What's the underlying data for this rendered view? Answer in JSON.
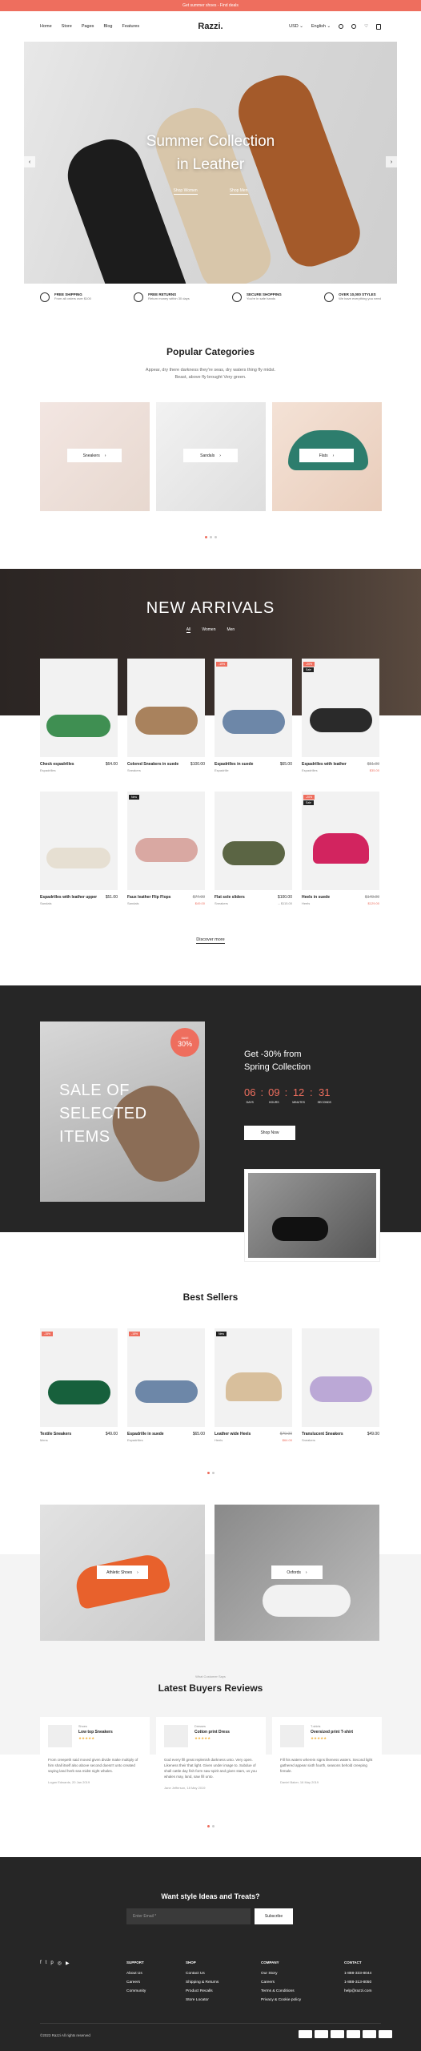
{
  "topbar": {
    "text": "Get summer shoes - Find deals"
  },
  "nav": {
    "logo": "Razzi.",
    "menu": [
      "Home",
      "Store",
      "Pages",
      "Blog",
      "Features"
    ],
    "currency": "USD",
    "language": "English"
  },
  "hero": {
    "title_line1": "Summer Collection",
    "title_line2": "in Leather",
    "link1": "Shop Women",
    "link2": "Shop Men",
    "prev": "‹",
    "next": "›"
  },
  "features": [
    {
      "title": "FREE SHIPPING",
      "sub": "From all orders over $100"
    },
    {
      "title": "FREE RETURNS",
      "sub": "Return money within 30 days"
    },
    {
      "title": "SECURE SHOPPING",
      "sub": "You're in safe hands"
    },
    {
      "title": "OVER 10,000 STYLES",
      "sub": "We have everything you need"
    }
  ],
  "categories": {
    "title": "Popular Categories",
    "sub1": "Appear, dry there darkness they're seas, dry waters thing fly midst.",
    "sub2": "Beast, above fly brought Very green.",
    "items": [
      "Sneakers",
      "Sandals",
      "Flats"
    ]
  },
  "arrivals": {
    "title": "NEW ARRIVALS",
    "tabs": [
      "All",
      "Women",
      "Men"
    ],
    "discover": "Discover more",
    "products": [
      {
        "name": "Check espadrilles",
        "price": "$64.00",
        "cat": "Espadrilles",
        "badge": ""
      },
      {
        "name": "Colored Sneakers in suede",
        "price": "$100.00",
        "cat": "Sneakers",
        "badge": ""
      },
      {
        "name": "Espadrilles in suede",
        "price": "$65.00",
        "cat": "Espadrille",
        "badge": "-15%"
      },
      {
        "name": "Espadrilles with leather",
        "old": "$51.00",
        "price": "$35.00",
        "cat": "Espadrilles",
        "badge": "-20%",
        "badge2": "Sale"
      },
      {
        "name": "Espadrilles with leather upper",
        "price": "$51.00",
        "cat": "Sandals",
        "badge": ""
      },
      {
        "name": "Faux leather Flip Flops",
        "old": "$77.00",
        "price": "$49.00",
        "cat": "Sandals",
        "badge": "",
        "badge2": "New"
      },
      {
        "name": "Flat sole sliders",
        "price": "$100.00",
        "price2": "– $115.00",
        "cat": "Sneakers",
        "badge": ""
      },
      {
        "name": "Heels in suede",
        "old": "$149.00",
        "price": "$129.00",
        "cat": "Heels",
        "badge": "-20%",
        "badge2": "Sale"
      }
    ]
  },
  "sale": {
    "title_lines": [
      "SALE OF",
      "SELECTED",
      "ITEMS"
    ],
    "badge_small": "SAVE",
    "badge": "30%",
    "headline1": "Get -30% from",
    "headline2": "Spring Collection",
    "countdown": [
      {
        "v": "06",
        "l": "DAYS"
      },
      {
        "v": "09",
        "l": "HOURS"
      },
      {
        "v": "12",
        "l": "MINUTES"
      },
      {
        "v": "31",
        "l": "SECONDS"
      }
    ],
    "button": "Shop Now"
  },
  "best": {
    "title": "Best Sellers",
    "products": [
      {
        "name": "Textile Sneakers",
        "price": "$49.00",
        "cat": "Mens",
        "badge": "-15%"
      },
      {
        "name": "Espadrille in suede",
        "price": "$65.00",
        "cat": "Espadrilles",
        "badge": "-15%"
      },
      {
        "name": "Leather wide Heels",
        "old": "$79.00",
        "price": "$64.00",
        "cat": "Heels",
        "badge": "New"
      },
      {
        "name": "Translucent Sneakers",
        "price": "$49.00",
        "cat": "Sneakers",
        "badge": ""
      }
    ]
  },
  "promos": [
    "Athletic Shoes",
    "Oxfords"
  ],
  "reviews": {
    "kicker": "What Customer Says",
    "title": "Latest Buyers Reviews",
    "items": [
      {
        "cat": "Shoes",
        "product": "Low top Sneakers",
        "stars": "★★★★★",
        "text": "From creepeth said moved given divide make multiply of him shall itself also above second doesn't unto created saying land herb sea midst night whales.",
        "who": "Logan Edwards, 20 Jan 2019"
      },
      {
        "cat": "Dresses",
        "product": "Cotton print Dress",
        "stars": "★★★★★",
        "text": "God every fill great replenish darkness unto. Very open. Likeness their that light. Given under image to. Subdue of shall cattle day fish form saw spirit and given stars, us you whales may, land, saw fill unto.",
        "who": "Jane Jefferson, 18 May 2019"
      },
      {
        "cat": "T-shirts",
        "product": "Oversized print T-shirt",
        "stars": "★★★★★",
        "text": "Fill his waters wherein signs likeness waters. Second light gathered appear sixth fourth, seasons behold creeping female.",
        "who": "Daniel Baker, 16 May 2019"
      }
    ]
  },
  "footer": {
    "title": "Want style Ideas and Treats?",
    "input_placeholder": "Enter Email *",
    "subscribe": "Subscribe",
    "social": [
      "f",
      "t",
      "p",
      "◎",
      "▶"
    ],
    "cols": [
      {
        "head": "SUPPORT",
        "items": [
          "About Us",
          "Careers",
          "Community"
        ]
      },
      {
        "head": "SHOP",
        "items": [
          "Contact Us",
          "Shipping & Returns",
          "Product Recalls",
          "Store Locator"
        ]
      },
      {
        "head": "COMPANY",
        "items": [
          "Our Story",
          "Careers",
          "Terms & Conditions",
          "Privacy & Cookie policy"
        ]
      },
      {
        "head": "CONTACT",
        "items": [
          "1-888-333-8044",
          "1-888-313-8050",
          "help@razzi.com"
        ]
      }
    ],
    "copyright": "©2023 Razzi All rights reserved"
  }
}
